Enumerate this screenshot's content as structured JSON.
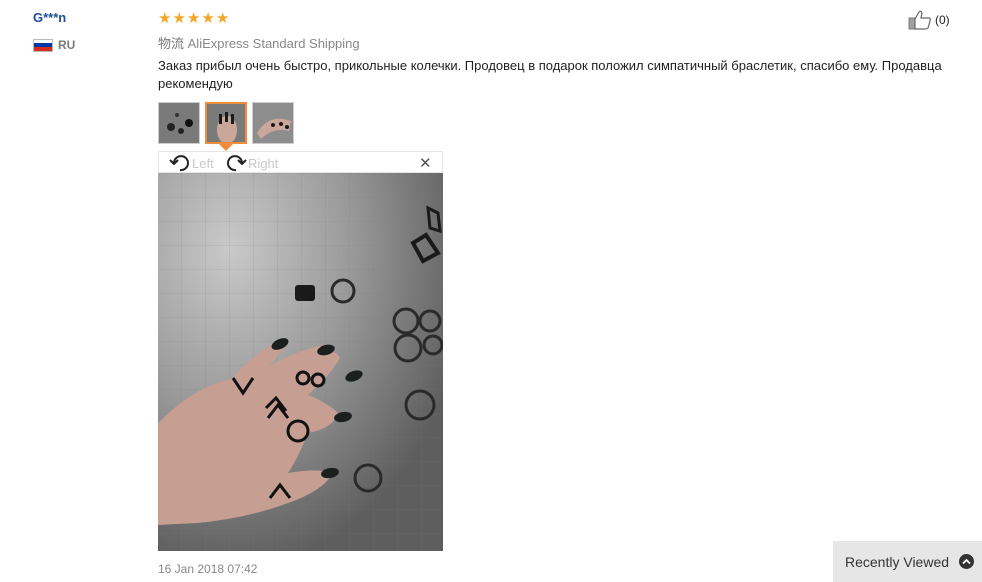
{
  "user": {
    "name": "G***n",
    "country_code": "RU",
    "flag_colors": [
      "#ffffff",
      "#0039a6",
      "#d52b1e"
    ]
  },
  "review": {
    "rating": 5,
    "star_glyph": "★",
    "shipping_label": "物流",
    "shipping_method": "AliExpress Standard Shipping",
    "text": "Заказ прибыл очень быстро, прикольные колечки. Продовец в подарок положил симпатичный браслетик, спасибо ему. Продавца рекомендую",
    "helpful_count": "(0)",
    "date": "16 Jan 2018 07:42"
  },
  "viewer": {
    "rotate_left_label": "Left",
    "rotate_right_label": "Right",
    "close_glyph": "✕",
    "selected_thumb": 2,
    "thumb_count": 3
  },
  "recently_viewed": {
    "label": "Recently Viewed"
  },
  "colors": {
    "accent_orange": "#f08c3a",
    "star": "#f5a623",
    "user_link": "#1e4b9b"
  }
}
